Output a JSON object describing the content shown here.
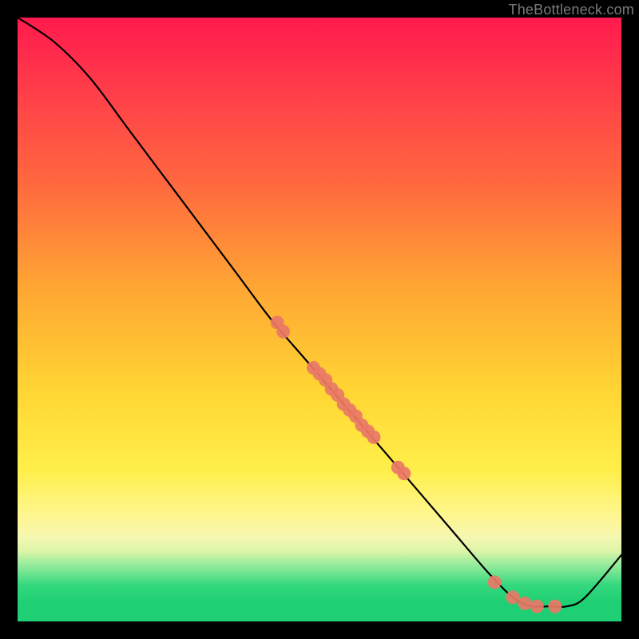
{
  "watermark": "TheBottleneck.com",
  "chart_data": {
    "type": "line",
    "title": "",
    "xlabel": "",
    "ylabel": "",
    "xlim": [
      0,
      100
    ],
    "ylim": [
      0,
      100
    ],
    "grid": false,
    "legend": false,
    "series": [
      {
        "name": "curve",
        "kind": "line",
        "color": "#000000",
        "points": [
          {
            "x": 0,
            "y": 100
          },
          {
            "x": 6,
            "y": 96
          },
          {
            "x": 12,
            "y": 90
          },
          {
            "x": 18,
            "y": 82
          },
          {
            "x": 24,
            "y": 74
          },
          {
            "x": 30,
            "y": 66
          },
          {
            "x": 36,
            "y": 58
          },
          {
            "x": 42,
            "y": 50
          },
          {
            "x": 48,
            "y": 43
          },
          {
            "x": 54,
            "y": 36
          },
          {
            "x": 60,
            "y": 29
          },
          {
            "x": 66,
            "y": 22
          },
          {
            "x": 72,
            "y": 15
          },
          {
            "x": 78,
            "y": 8
          },
          {
            "x": 82,
            "y": 4
          },
          {
            "x": 85,
            "y": 2.5
          },
          {
            "x": 88,
            "y": 2.5
          },
          {
            "x": 91,
            "y": 2.5
          },
          {
            "x": 94,
            "y": 4
          },
          {
            "x": 100,
            "y": 11
          }
        ]
      },
      {
        "name": "dots",
        "kind": "scatter",
        "color": "#e97866",
        "points": [
          {
            "x": 43,
            "y": 49.5
          },
          {
            "x": 44,
            "y": 48
          },
          {
            "x": 49,
            "y": 42
          },
          {
            "x": 50,
            "y": 41
          },
          {
            "x": 51,
            "y": 40
          },
          {
            "x": 52,
            "y": 38.5
          },
          {
            "x": 53,
            "y": 37.5
          },
          {
            "x": 54,
            "y": 36
          },
          {
            "x": 55,
            "y": 35
          },
          {
            "x": 56,
            "y": 34
          },
          {
            "x": 57,
            "y": 32.5
          },
          {
            "x": 58,
            "y": 31.5
          },
          {
            "x": 59,
            "y": 30.5
          },
          {
            "x": 63,
            "y": 25.5
          },
          {
            "x": 64,
            "y": 24.5
          },
          {
            "x": 79,
            "y": 6.5
          },
          {
            "x": 82,
            "y": 4
          },
          {
            "x": 84,
            "y": 3
          },
          {
            "x": 86,
            "y": 2.5
          },
          {
            "x": 89,
            "y": 2.5
          }
        ]
      }
    ]
  }
}
